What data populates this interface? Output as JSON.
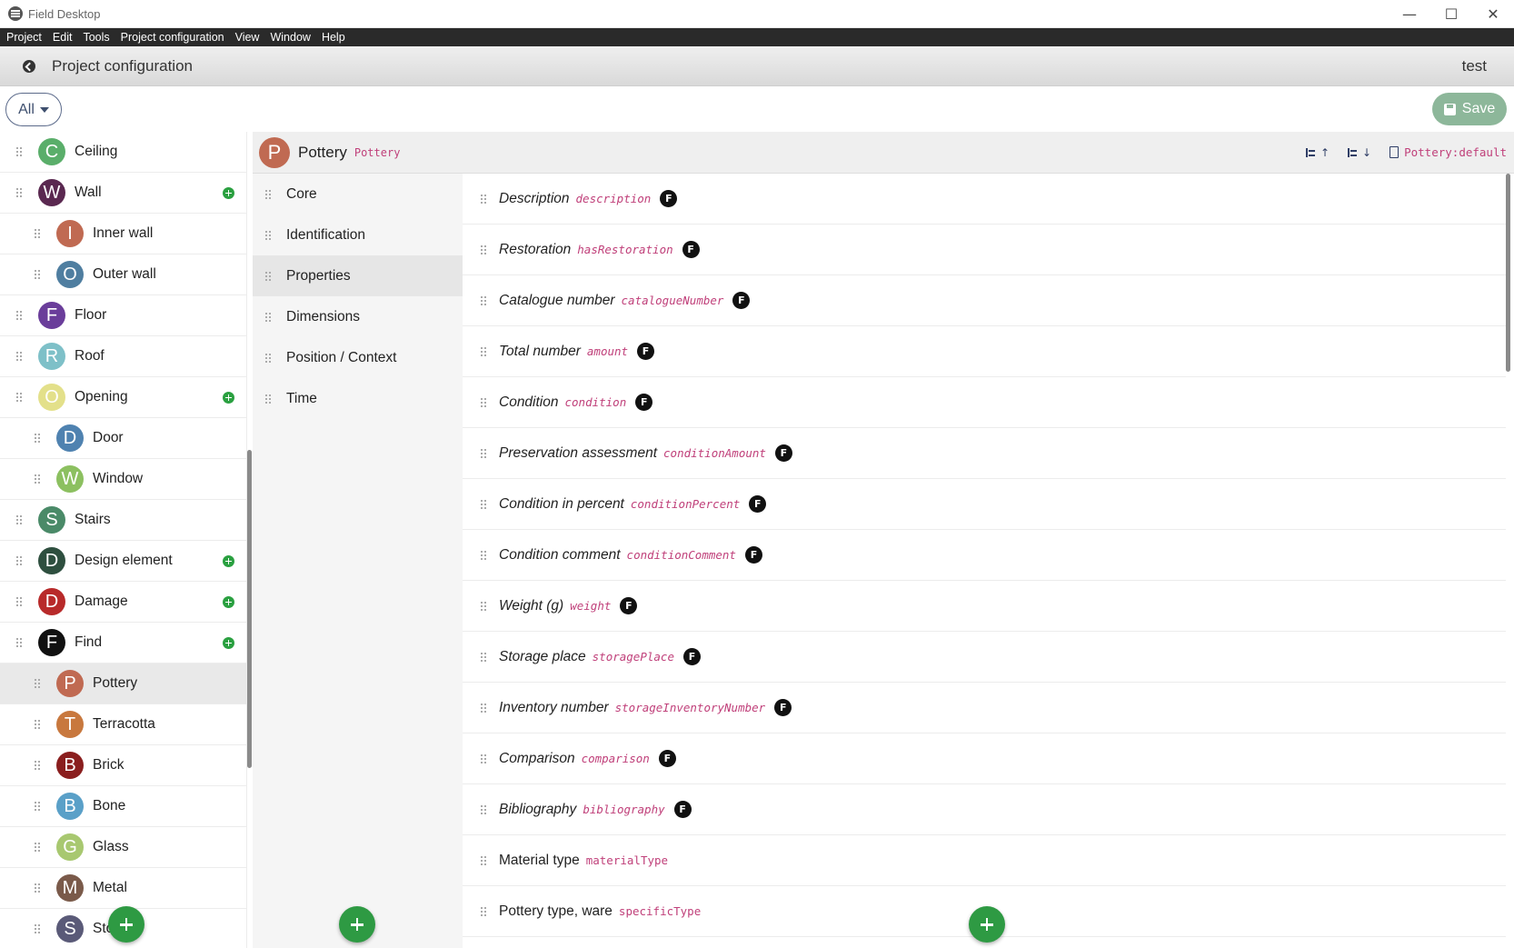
{
  "window": {
    "title": "Field Desktop",
    "minimize": "—",
    "maximize": "☐",
    "close": "✕"
  },
  "menu": [
    "Project",
    "Edit",
    "Tools",
    "Project configuration",
    "View",
    "Window",
    "Help"
  ],
  "header": {
    "title": "Project configuration",
    "project": "test"
  },
  "toolbar": {
    "filter": "All",
    "save": "Save"
  },
  "categories": [
    {
      "letter": "C",
      "label": "Ceiling",
      "color": "#5aae6a",
      "indent": false,
      "plus": false
    },
    {
      "letter": "W",
      "label": "Wall",
      "color": "#5a2850",
      "indent": false,
      "plus": true
    },
    {
      "letter": "I",
      "label": "Inner wall",
      "color": "#c06a52",
      "indent": true,
      "plus": false
    },
    {
      "letter": "O",
      "label": "Outer wall",
      "color": "#4f7ea0",
      "indent": true,
      "plus": false
    },
    {
      "letter": "F",
      "label": "Floor",
      "color": "#6a3d9a",
      "indent": false,
      "plus": false
    },
    {
      "letter": "R",
      "label": "Roof",
      "color": "#7ec0c8",
      "indent": false,
      "plus": false
    },
    {
      "letter": "O",
      "label": "Opening",
      "color": "#e3e08a",
      "indent": false,
      "plus": true
    },
    {
      "letter": "D",
      "label": "Door",
      "color": "#4f82b0",
      "indent": true,
      "plus": false
    },
    {
      "letter": "W",
      "label": "Window",
      "color": "#8cc060",
      "indent": true,
      "plus": false
    },
    {
      "letter": "S",
      "label": "Stairs",
      "color": "#4a8a68",
      "indent": false,
      "plus": false
    },
    {
      "letter": "D",
      "label": "Design element",
      "color": "#2e4f3f",
      "indent": false,
      "plus": true
    },
    {
      "letter": "D",
      "label": "Damage",
      "color": "#b82a2a",
      "indent": false,
      "plus": true
    },
    {
      "letter": "F",
      "label": "Find",
      "color": "#111111",
      "indent": false,
      "plus": true
    },
    {
      "letter": "P",
      "label": "Pottery",
      "color": "#c06a52",
      "indent": true,
      "plus": false,
      "selected": true
    },
    {
      "letter": "T",
      "label": "Terracotta",
      "color": "#c8783e",
      "indent": true,
      "plus": false
    },
    {
      "letter": "B",
      "label": "Brick",
      "color": "#8a1e1e",
      "indent": true,
      "plus": false
    },
    {
      "letter": "B",
      "label": "Bone",
      "color": "#5aa0c8",
      "indent": true,
      "plus": false
    },
    {
      "letter": "G",
      "label": "Glass",
      "color": "#a8c870",
      "indent": true,
      "plus": false
    },
    {
      "letter": "M",
      "label": "Metal",
      "color": "#7a5a4a",
      "indent": true,
      "plus": false
    },
    {
      "letter": "S",
      "label": "Sto",
      "color": "#5a5a78",
      "indent": true,
      "plus": false
    }
  ],
  "type": {
    "letter": "P",
    "label": "Pottery",
    "code": "Pottery",
    "form": "Pottery:default",
    "up_arrow": "↑",
    "down_arrow": "↓"
  },
  "groups": [
    {
      "label": "Core"
    },
    {
      "label": "Identification"
    },
    {
      "label": "Properties",
      "selected": true
    },
    {
      "label": "Dimensions"
    },
    {
      "label": "Position / Context"
    },
    {
      "label": "Time"
    }
  ],
  "fields": [
    {
      "label": "Description",
      "code": "description",
      "badge": "F"
    },
    {
      "label": "Restoration",
      "code": "hasRestoration",
      "badge": "F"
    },
    {
      "label": "Catalogue number",
      "code": "catalogueNumber",
      "badge": "F"
    },
    {
      "label": "Total number",
      "code": "amount",
      "badge": "F"
    },
    {
      "label": "Condition",
      "code": "condition",
      "badge": "F"
    },
    {
      "label": "Preservation assessment",
      "code": "conditionAmount",
      "badge": "F"
    },
    {
      "label": "Condition in percent",
      "code": "conditionPercent",
      "badge": "F"
    },
    {
      "label": "Condition comment",
      "code": "conditionComment",
      "badge": "F"
    },
    {
      "label": "Weight (g)",
      "code": "weight",
      "badge": "F"
    },
    {
      "label": "Storage place",
      "code": "storagePlace",
      "badge": "F"
    },
    {
      "label": "Inventory number",
      "code": "storageInventoryNumber",
      "badge": "F"
    },
    {
      "label": "Comparison",
      "code": "comparison",
      "badge": "F"
    },
    {
      "label": "Bibliography",
      "code": "bibliography",
      "badge": "F"
    },
    {
      "label": "Material type",
      "code": "materialType",
      "badge": ""
    },
    {
      "label": "Pottery type, ware",
      "code": "specificType",
      "badge": ""
    }
  ]
}
